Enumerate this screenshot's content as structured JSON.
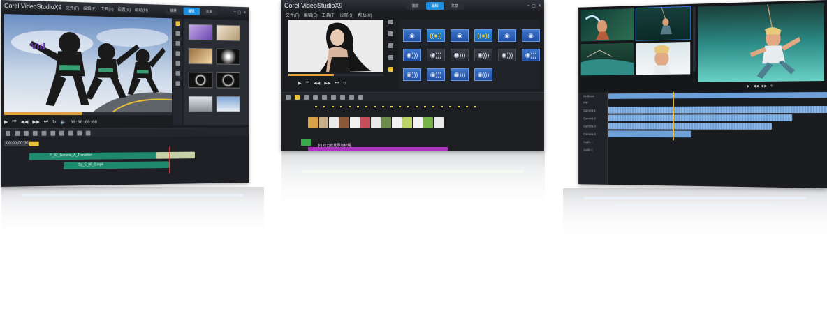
{
  "app_title_prefix": "Corel",
  "app_title_name": "VideoStudio",
  "app_title_version": "X9",
  "screen1": {
    "menu": [
      "文件(F)",
      "编辑(E)",
      "工具(T)",
      "设置(S)",
      "帮助(H)"
    ],
    "tabs": [
      "捕获",
      "编辑",
      "共享"
    ],
    "active_tab": 1,
    "overlay_text": "Vid",
    "timecode": "00:00:00:00",
    "project_label": "00:00:00:00",
    "track_video_label": "P_02_Generic_A_Transition",
    "track_overlay_label": "Sp_E_06_0.mp4",
    "gallery_captions": [
      "",
      "",
      "",
      "",
      "",
      "",
      "",
      ""
    ]
  },
  "screen2": {
    "menu": [
      "文件(F)",
      "编辑(E)",
      "工具(T)",
      "设置(S)",
      "帮助(H)"
    ],
    "tabs": [
      "捕获",
      "编辑",
      "共享"
    ],
    "active_tab": 1,
    "fx_labels": [
      "",
      "",
      "",
      "",
      "",
      "",
      "",
      "",
      "",
      "",
      "",
      "",
      "",
      "",
      "",
      ""
    ],
    "track_title_label": "[T] 双击此处添加标题"
  },
  "screen3": {
    "track_labels": [
      "Multicam",
      "PIP",
      "Camera 1",
      "Camera 2",
      "Camera 3",
      "Camera 4",
      "Audio 1",
      "Audio 2"
    ]
  }
}
